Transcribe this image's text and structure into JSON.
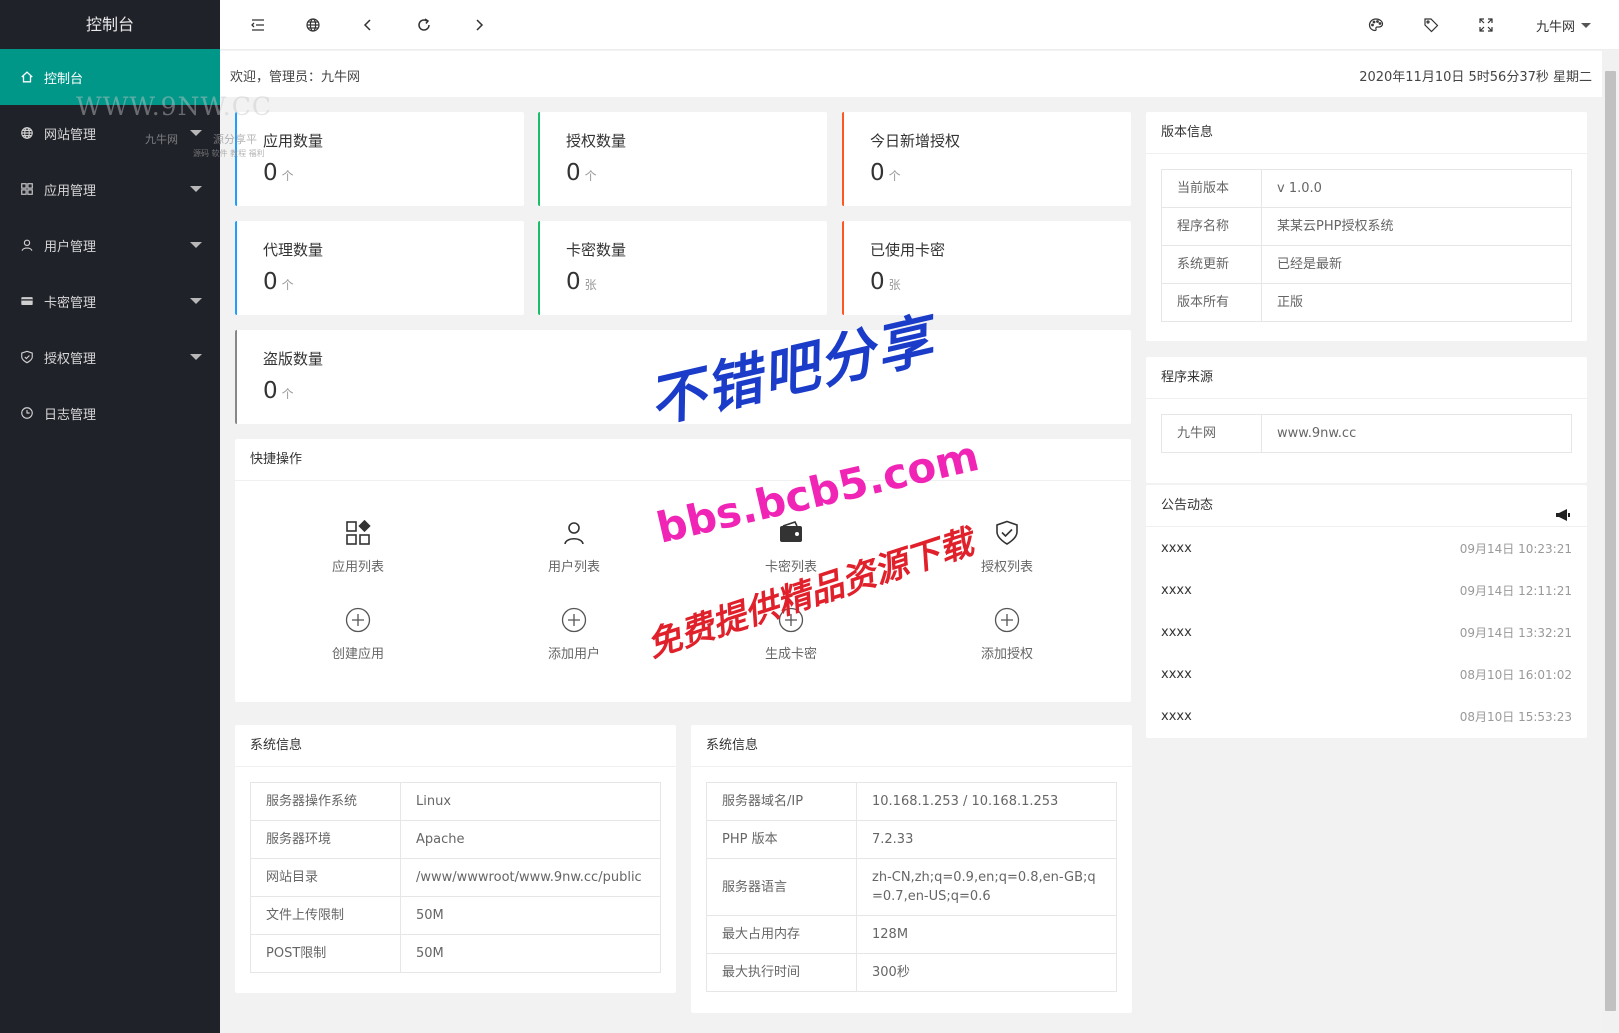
{
  "sidebar": {
    "logo": "控制台",
    "items": [
      {
        "label": "控制台",
        "icon": "home-icon",
        "active": true
      },
      {
        "label": "网站管理",
        "icon": "globe-icon",
        "expandable": true
      },
      {
        "label": "应用管理",
        "icon": "apps-icon",
        "expandable": true
      },
      {
        "label": "用户管理",
        "icon": "user-icon",
        "expandable": true
      },
      {
        "label": "卡密管理",
        "icon": "card-icon",
        "expandable": true
      },
      {
        "label": "授权管理",
        "icon": "shield-icon",
        "expandable": true
      },
      {
        "label": "日志管理",
        "icon": "clock-icon"
      }
    ]
  },
  "watermarks": {
    "site_mark": "WWW.9NW.CC",
    "site_name": "九牛网",
    "site_slogan": "源分享平",
    "site_tags": "源码 软件 教程 福利",
    "line1": "不错吧分享",
    "line2": "bbs.bcb5.com",
    "line3": "免费提供精品资源下载"
  },
  "header": {
    "icons": [
      "menu-fold-icon",
      "globe-icon",
      "chevron-left-icon",
      "refresh-icon",
      "chevron-right-icon"
    ],
    "right_icons": [
      "palette-icon",
      "tag-icon",
      "fullscreen-icon"
    ],
    "user": "九牛网"
  },
  "welcome": {
    "text": "欢迎，管理员：九牛网",
    "datetime": "2020年11月10日 5时56分37秒 星期二"
  },
  "stats": [
    {
      "title": "应用数量",
      "value": "0",
      "unit": "个",
      "accent": "#1e9fff"
    },
    {
      "title": "授权数量",
      "value": "0",
      "unit": "个",
      "accent": "#19be6b"
    },
    {
      "title": "今日新增授权",
      "value": "0",
      "unit": "个",
      "accent": "#ff5722"
    },
    {
      "title": "代理数量",
      "value": "0",
      "unit": "个",
      "accent": "#1e9fff"
    },
    {
      "title": "卡密数量",
      "value": "0",
      "unit": "张",
      "accent": "#19be6b"
    },
    {
      "title": "已使用卡密",
      "value": "0",
      "unit": "张",
      "accent": "#ff5722"
    },
    {
      "title": "盗版数量",
      "value": "0",
      "unit": "个",
      "accent": "#888888"
    }
  ],
  "quick": {
    "title": "快捷操作",
    "items": [
      {
        "label": "应用列表",
        "icon": "apps-icon"
      },
      {
        "label": "用户列表",
        "icon": "user-icon"
      },
      {
        "label": "卡密列表",
        "icon": "wallet-icon"
      },
      {
        "label": "授权列表",
        "icon": "shield-check-icon"
      },
      {
        "label": "创建应用",
        "icon": "plus-circle-icon"
      },
      {
        "label": "添加用户",
        "icon": "plus-circle-icon"
      },
      {
        "label": "生成卡密",
        "icon": "plus-circle-icon"
      },
      {
        "label": "添加授权",
        "icon": "plus-circle-icon"
      }
    ]
  },
  "sysinfo1": {
    "title": "系统信息",
    "rows": [
      {
        "k": "服务器操作系统",
        "v": "Linux"
      },
      {
        "k": "服务器环境",
        "v": "Apache"
      },
      {
        "k": "网站目录",
        "v": "/www/wwwroot/www.9nw.cc/public"
      },
      {
        "k": "文件上传限制",
        "v": "50M"
      },
      {
        "k": "POST限制",
        "v": "50M"
      }
    ]
  },
  "sysinfo2": {
    "title": "系统信息",
    "rows": [
      {
        "k": "服务器域名/IP",
        "v": "10.168.1.253 / 10.168.1.253"
      },
      {
        "k": "PHP 版本",
        "v": "7.2.33"
      },
      {
        "k": "服务器语言",
        "v": "zh-CN,zh;q=0.9,en;q=0.8,en-GB;q=0.7,en-US;q=0.6"
      },
      {
        "k": "最大占用内存",
        "v": "128M"
      },
      {
        "k": "最大执行时间",
        "v": "300秒"
      }
    ]
  },
  "version": {
    "title": "版本信息",
    "rows": [
      {
        "k": "当前版本",
        "v": "v 1.0.0"
      },
      {
        "k": "程序名称",
        "v": "某某云PHP授权系统"
      },
      {
        "k": "系统更新",
        "v": "已经是最新"
      },
      {
        "k": "版本所有",
        "v": "正版"
      }
    ]
  },
  "source": {
    "title": "程序来源",
    "rows": [
      {
        "k": "九牛网",
        "v": "www.9nw.cc"
      }
    ]
  },
  "notices": {
    "title": "公告动态",
    "icon": "megaphone-icon",
    "items": [
      {
        "title": "xxxx",
        "time": "09月14日 10:23:21"
      },
      {
        "title": "xxxx",
        "time": "09月14日 12:11:21"
      },
      {
        "title": "xxxx",
        "time": "09月14日 13:32:21"
      },
      {
        "title": "xxxx",
        "time": "08月10日 16:01:02"
      },
      {
        "title": "xxxx",
        "time": "08月10日 15:53:23"
      }
    ]
  }
}
